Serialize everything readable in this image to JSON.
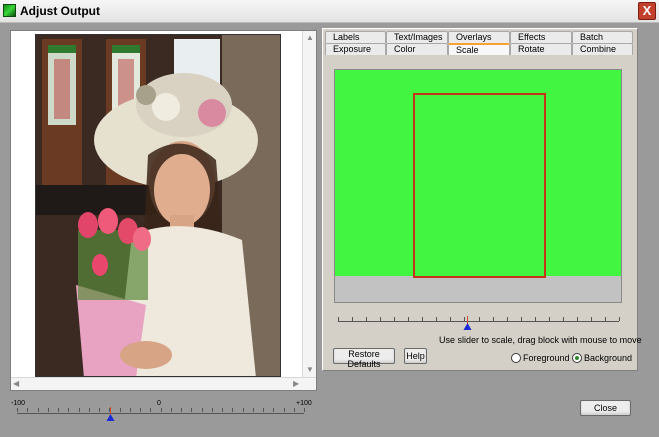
{
  "window": {
    "title": "Adjust Output",
    "close_glyph": "X"
  },
  "left_slider": {
    "min_label": "-100",
    "mid_label": "0",
    "max_label": "+100",
    "value": -35
  },
  "tabs_row1": [
    "Labels",
    "Text/Images",
    "Overlays",
    "Effects",
    "Batch"
  ],
  "tabs_row2": [
    "Exposure",
    "Color",
    "Scale",
    "Rotate",
    "Combine"
  ],
  "active_tab": "Scale",
  "scale_slider": {
    "value_fraction": 0.46
  },
  "instructions": "Use slider to scale,  drag block with mouse to move",
  "buttons": {
    "restore_defaults": "Restore Defaults",
    "help": "Help",
    "close": "Close"
  },
  "radios": {
    "foreground": "Foreground",
    "background": "Background",
    "selected": "background"
  },
  "colors": {
    "preview_green": "#41f540",
    "crop_outline": "#c5351a",
    "slider_thumb": "#1a2ad6"
  }
}
